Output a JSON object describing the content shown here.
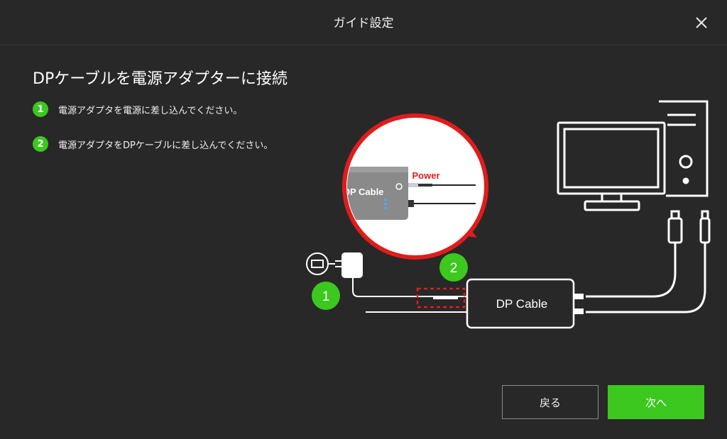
{
  "dialog": {
    "title": "ガイド設定",
    "heading": "DPケーブルを電源アダプターに接続"
  },
  "steps": [
    {
      "num": "1",
      "text": "電源アダプタを電源に差し込んでください。"
    },
    {
      "num": "2",
      "text": "電源アダプタをDPケーブルに差し込んでください。"
    }
  ],
  "illustration": {
    "zoom_device_label": "DP Cable",
    "zoom_power_label": "Power",
    "cable_box_label": "DP Cable",
    "marker_1": "1",
    "marker_2": "2"
  },
  "buttons": {
    "back": "戻る",
    "next": "次へ"
  },
  "colors": {
    "background": "#282828",
    "accent_green": "#3cc81e",
    "highlight_red": "#e01c1c"
  }
}
